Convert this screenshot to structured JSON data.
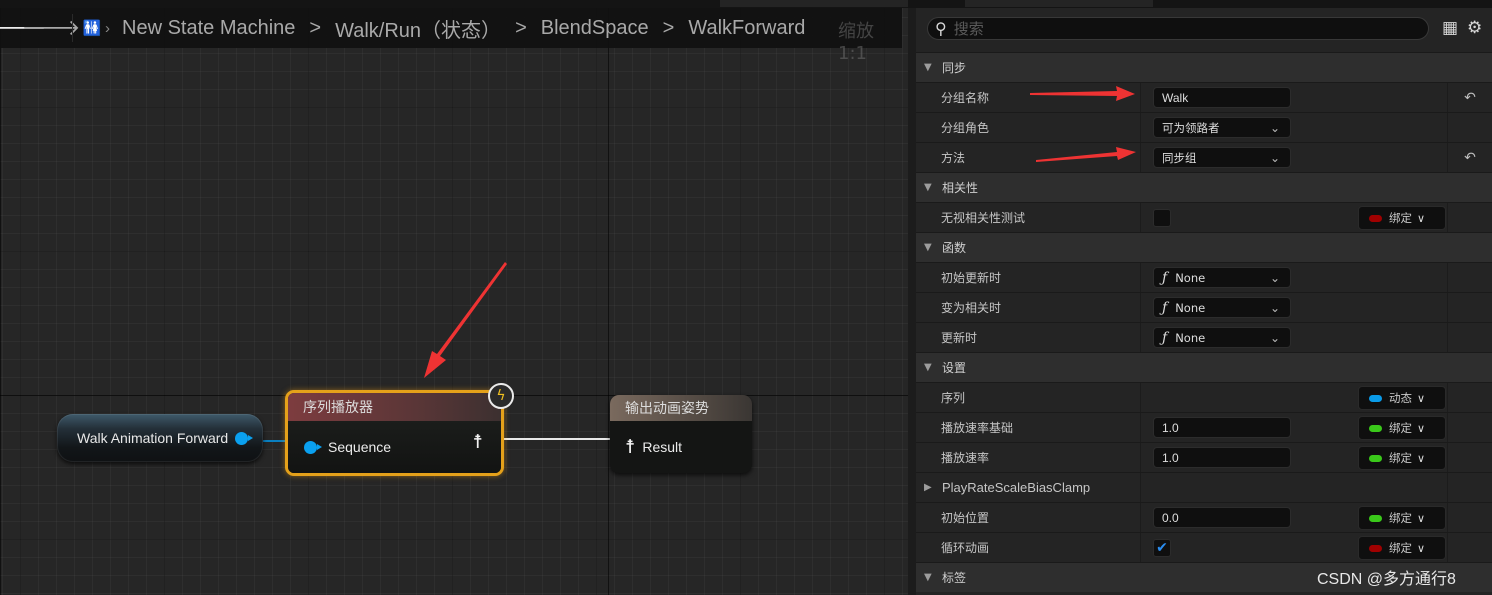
{
  "breadcrumb": {
    "back_icon": "arrow-left-icon",
    "forward_icon": "arrow-right-icon",
    "root_icon": "anim-blueprint-icon",
    "items": [
      "New State Machine",
      "Walk/Run（状态）",
      "BlendSpace",
      "WalkForward"
    ],
    "separator": ">",
    "zoom_label": "缩放1:1"
  },
  "graph": {
    "nodes": {
      "variable": {
        "label": "Walk Animation Forward",
        "pin_color": "#0aa0ef"
      },
      "sequence_player": {
        "title": "序列播放器",
        "input_pin": "Sequence",
        "output_icon": "pose-icon",
        "badge_icon": "fast-path-lightning-icon",
        "border_color": "#e5a11a",
        "selected": true
      },
      "output_pose": {
        "title": "输出动画姿势",
        "input_pin": "Result",
        "input_icon": "pose-icon"
      }
    },
    "annotations": {
      "arrow_color": "#ee3333"
    }
  },
  "details": {
    "search": {
      "placeholder": "搜索",
      "value": ""
    },
    "toolbar": {
      "table_icon": "table-view-icon",
      "settings_icon": "gear-icon"
    },
    "sections": [
      {
        "label": "同步",
        "expanded": true,
        "rows": [
          {
            "label": "分组名称",
            "kind": "text",
            "value": "Walk",
            "reset": true
          },
          {
            "label": "分组角色",
            "kind": "combo",
            "value": "可为领路者"
          },
          {
            "label": "方法",
            "kind": "combo",
            "value": "同步组",
            "reset": true
          }
        ]
      },
      {
        "label": "相关性",
        "expanded": true,
        "rows": [
          {
            "label": "无视相关性测试",
            "kind": "checkbox",
            "checked": false,
            "binding": {
              "label": "绑定",
              "color": "#a00000"
            }
          }
        ]
      },
      {
        "label": "函数",
        "expanded": true,
        "rows": [
          {
            "label": "初始更新时",
            "kind": "function",
            "value": "None"
          },
          {
            "label": "变为相关时",
            "kind": "function",
            "value": "None"
          },
          {
            "label": "更新时",
            "kind": "function",
            "value": "None"
          }
        ]
      },
      {
        "label": "设置",
        "expanded": true,
        "rows": [
          {
            "label": "序列",
            "kind": "empty",
            "binding": {
              "label": "动态",
              "color": "#0a9be8"
            }
          },
          {
            "label": "播放速率基础",
            "kind": "text",
            "value": "1.0",
            "binding": {
              "label": "绑定",
              "color": "#3ac81a"
            }
          },
          {
            "label": "播放速率",
            "kind": "text",
            "value": "1.0",
            "binding": {
              "label": "绑定",
              "color": "#3ac81a"
            }
          },
          {
            "label": "PlayRateScaleBiasClamp",
            "kind": "struct",
            "expanded": false
          },
          {
            "label": "初始位置",
            "kind": "text",
            "value": "0.0",
            "binding": {
              "label": "绑定",
              "color": "#3ac81a"
            }
          },
          {
            "label": "循环动画",
            "kind": "checkbox",
            "checked": true,
            "binding": {
              "label": "绑定",
              "color": "#a00000"
            }
          }
        ]
      },
      {
        "label": "标签",
        "expanded": true,
        "rows": []
      }
    ]
  },
  "watermark": "CSDN @多方通行8"
}
